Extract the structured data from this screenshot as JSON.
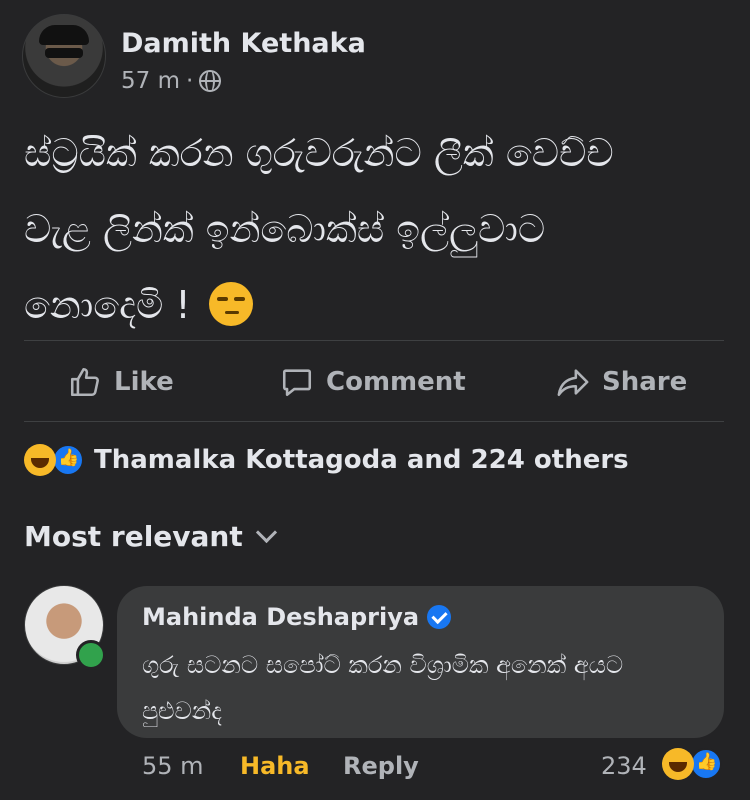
{
  "post": {
    "author": "Damith Kethaka",
    "time": "57 m",
    "separator": "·",
    "text_line1": "ස්ට්‍රයික් කරන ගුරුවරුන්ට ලීක් වෙච්ච",
    "text_line2": "වැළ ලින්ක් ඉන්බොක්ස් ඉල්ලුවාට",
    "text_line3": "නොදෙමි ! ",
    "emoji": "unamused-face"
  },
  "actions": {
    "like": "Like",
    "comment": "Comment",
    "share": "Share"
  },
  "reactions": {
    "text": "Thamalka Kottagoda and 224 others",
    "icons": [
      "haha-icon",
      "like-icon"
    ]
  },
  "sort": {
    "label": "Most relevant"
  },
  "comment": {
    "author": "Mahinda Deshapriya",
    "verified": true,
    "text": "ගුරු සටනට සපෝට් කරන විශ්‍රාමික  අනෙක් අයට\nපුළුවන්ද",
    "time": "55 m",
    "reaction_label": "Haha",
    "reply": "Reply",
    "count": "234"
  },
  "colors": {
    "background": "#232325",
    "bubble": "#3a3b3c",
    "haha": "#f7b928",
    "like": "#1877f2",
    "online": "#31a24c"
  }
}
